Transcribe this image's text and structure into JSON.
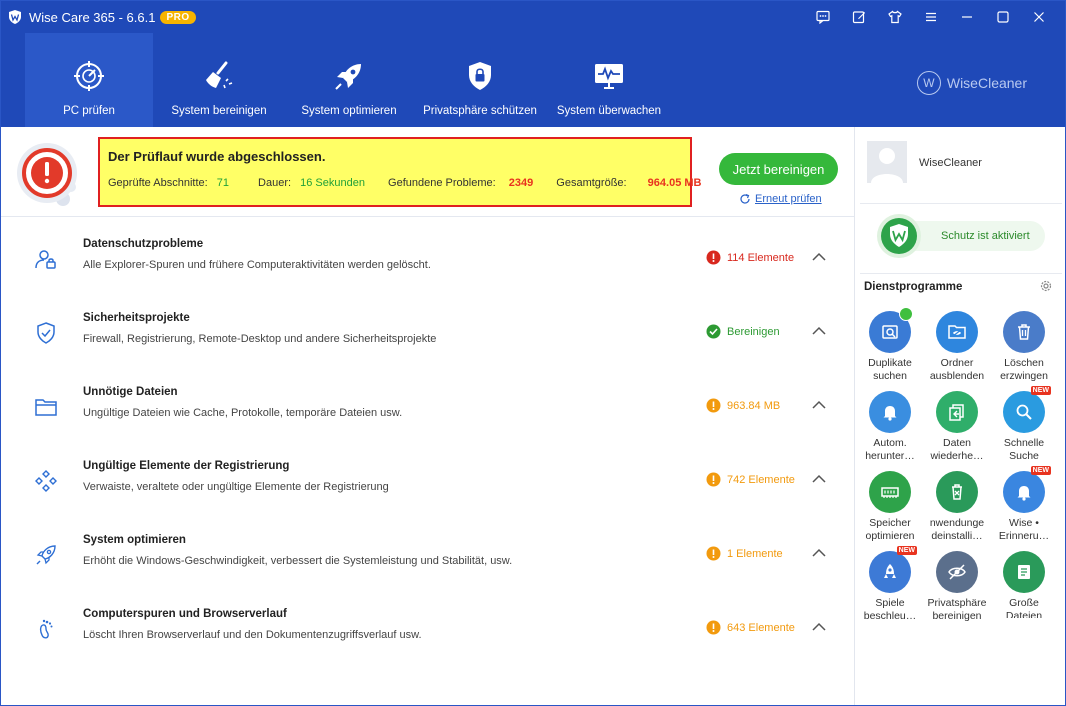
{
  "app": {
    "title": "Wise Care 365 - 6.6.1",
    "badge": "PRO"
  },
  "nav": {
    "items": [
      {
        "label": "PC prüfen",
        "icon": "target-scan-icon"
      },
      {
        "label": "System bereinigen",
        "icon": "broom-icon"
      },
      {
        "label": "System optimieren",
        "icon": "rocket-icon"
      },
      {
        "label": "Privatsphäre schützen",
        "icon": "shield-lock-icon"
      },
      {
        "label": "System überwachen",
        "icon": "monitor-pulse-icon"
      }
    ],
    "brand": "WiseCleaner",
    "brand_logo": "W"
  },
  "summary": {
    "title": "Der Prüflauf wurde abgeschlossen.",
    "sections_label": "Geprüfte Abschnitte:",
    "sections_value": "71",
    "duration_label": "Dauer:",
    "duration_value": "16 Sekunden",
    "problems_label": "Gefundene Probleme:",
    "problems_value": "2349",
    "size_label": "Gesamtgröße:",
    "size_value": "964.05 MB",
    "clean_button": "Jetzt bereinigen",
    "rescan_link": "Erneut prüfen"
  },
  "results": [
    {
      "title": "Datenschutzprobleme",
      "desc": "Alle Explorer-Spuren und frühere Computeraktivitäten werden gelöscht.",
      "status": "114 Elemente",
      "level": "error",
      "color": "#d8281e"
    },
    {
      "title": "Sicherheitsprojekte",
      "desc": "Firewall, Registrierung, Remote-Desktop und andere Sicherheitsprojekte",
      "status": "Bereinigen",
      "level": "ok",
      "color": "#2d9a33"
    },
    {
      "title": "Unnötige Dateien",
      "desc": "Ungültige Dateien wie Cache, Protokolle, temporäre Dateien usw.",
      "status": "963.84 MB",
      "level": "warn",
      "color": "#f29a0e"
    },
    {
      "title": "Ungültige Elemente der Registrierung",
      "desc": "Verwaiste, veraltete oder ungültige Elemente der Registrierung",
      "status": "742 Elemente",
      "level": "warn",
      "color": "#f29a0e"
    },
    {
      "title": "System optimieren",
      "desc": "Erhöht die Windows-Geschwindigkeit, verbessert die Systemleistung und Stabilität, usw.",
      "status": "1 Elemente",
      "level": "warn",
      "color": "#f29a0e"
    },
    {
      "title": "Computerspuren und Browserverlauf",
      "desc": "Löscht Ihren Browserverlauf und den Dokumentenzugriffsverlauf usw.",
      "status": "643 Elemente",
      "level": "warn",
      "color": "#f29a0e"
    }
  ],
  "side": {
    "user": "WiseCleaner",
    "protection": "Schutz ist aktiviert",
    "tools_title": "Dienstprogramme",
    "new_badge": "NEW",
    "tools": [
      {
        "l1": "Duplikate",
        "l2": "suchen",
        "color": "#3a7bd5",
        "icon": "duplicate-scan-icon"
      },
      {
        "l1": "Ordner",
        "l2": "ausblenden",
        "color": "#2e86de",
        "icon": "hide-folder-icon"
      },
      {
        "l1": "Löschen",
        "l2": "erzwingen",
        "color": "#4a7cc9",
        "icon": "trash-icon"
      },
      {
        "l1": "Autom.",
        "l2": "herunter…",
        "color": "#3a8ee0",
        "icon": "bell-icon"
      },
      {
        "l1": "Daten",
        "l2": "wiederhe…",
        "color": "#2fae6a",
        "icon": "restore-icon"
      },
      {
        "l1": "Schnelle",
        "l2": "Suche",
        "color": "#2a9be0",
        "icon": "search-icon"
      },
      {
        "l1": "Speicher",
        "l2": "optimieren",
        "color": "#2ea34a",
        "icon": "memory-icon"
      },
      {
        "l1": "nwendunge",
        "l2": "deinstalli…",
        "color": "#2a9a5a",
        "icon": "uninstall-icon"
      },
      {
        "l1": "Wise •",
        "l2": "Erinneru…",
        "color": "#3a86e0",
        "icon": "reminder-bell-icon"
      },
      {
        "l1": "Spiele",
        "l2": "beschleu…",
        "color": "#3d7ad6",
        "icon": "game-boost-icon"
      },
      {
        "l1": "Privatsphäre",
        "l2": "bereinigen",
        "color": "#5b6f8c",
        "icon": "privacy-eye-icon"
      },
      {
        "l1": "Große",
        "l2": "Dateien",
        "color": "#2a9a5a",
        "icon": "large-files-icon"
      }
    ]
  }
}
